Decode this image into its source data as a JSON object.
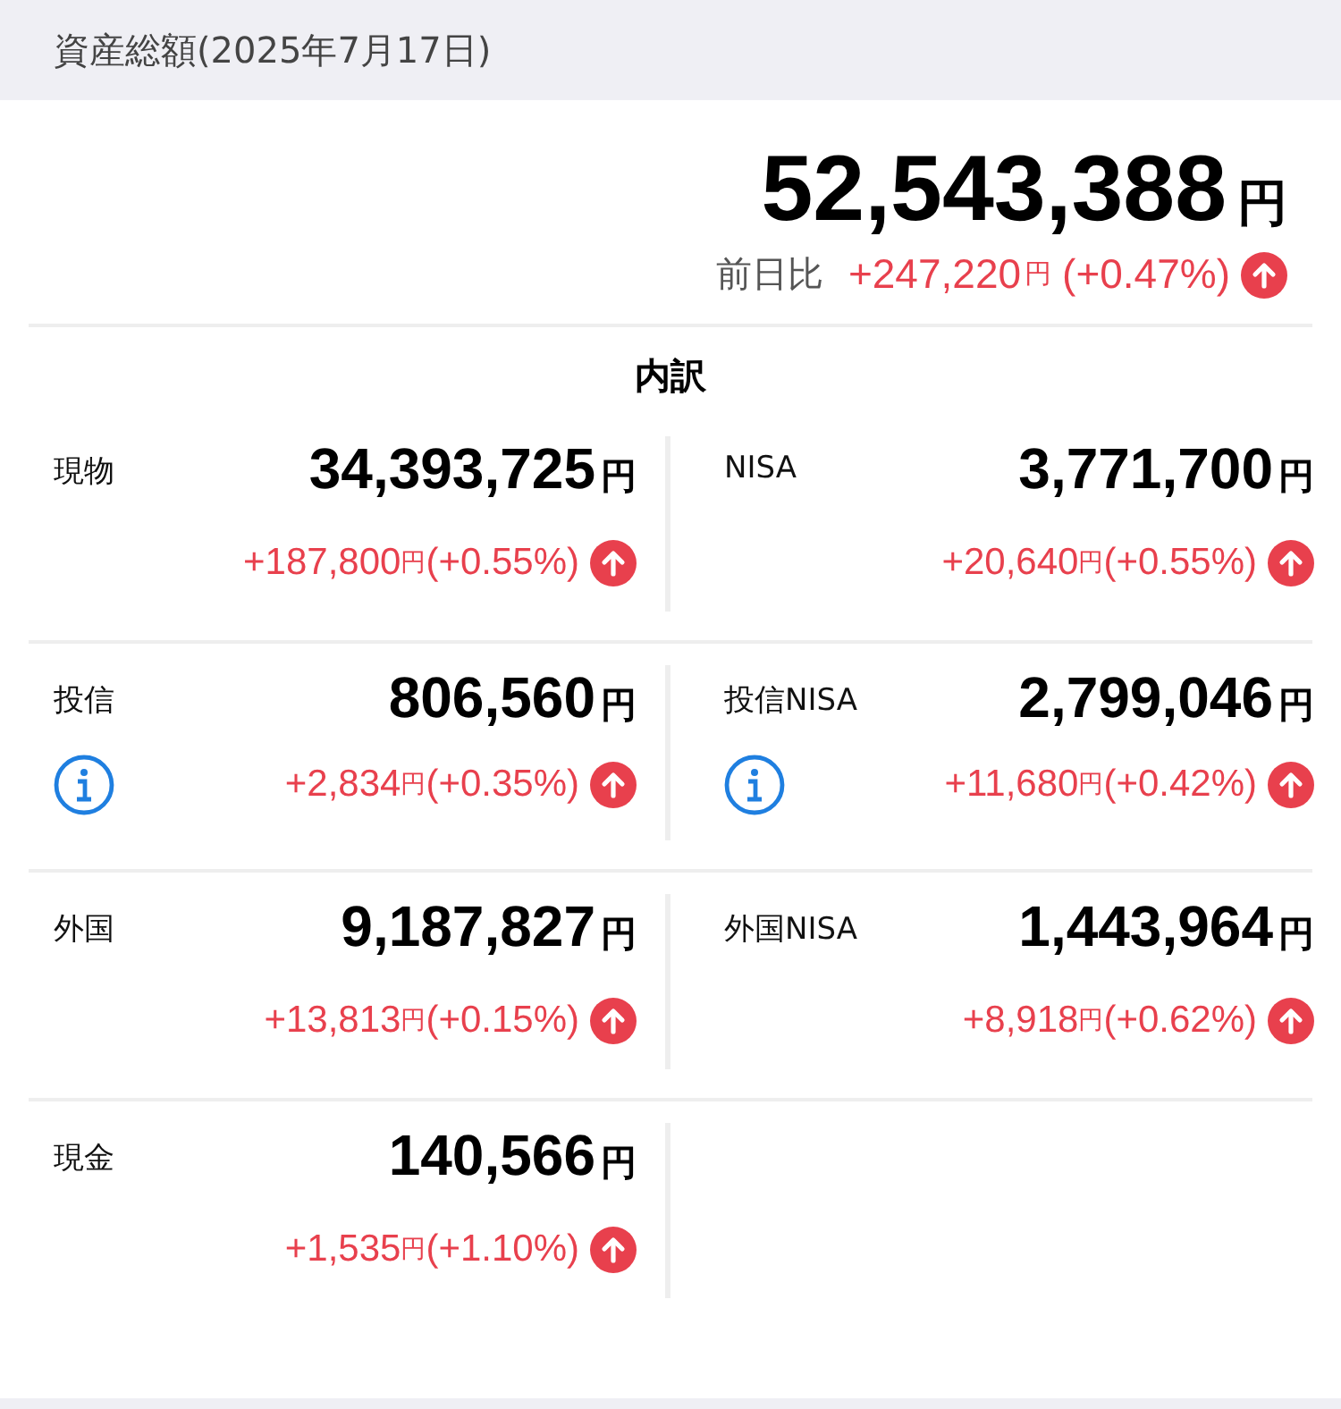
{
  "header": {
    "title": "資産総額(2025年7月17日)"
  },
  "total": {
    "amount": "52,543,388",
    "unit": "円",
    "change_label": "前日比",
    "change": "+247,220",
    "change_unit": "円",
    "change_pct": "(+0.47%)",
    "up": true
  },
  "breakdown": {
    "title": "内訳",
    "items": [
      {
        "label": "現物",
        "amount": "34,393,725",
        "unit": "円",
        "change": "+187,800",
        "change_unit": "円",
        "change_pct": "(+0.55%)",
        "up": true,
        "info": false
      },
      {
        "label": "NISA",
        "amount": "3,771,700",
        "unit": "円",
        "change": "+20,640",
        "change_unit": "円",
        "change_pct": "(+0.55%)",
        "up": true,
        "info": false
      },
      {
        "label": "投信",
        "amount": "806,560",
        "unit": "円",
        "change": "+2,834",
        "change_unit": "円",
        "change_pct": "(+0.35%)",
        "up": true,
        "info": true
      },
      {
        "label": "投信NISA",
        "amount": "2,799,046",
        "unit": "円",
        "change": "+11,680",
        "change_unit": "円",
        "change_pct": "(+0.42%)",
        "up": true,
        "info": true
      },
      {
        "label": "外国",
        "amount": "9,187,827",
        "unit": "円",
        "change": "+13,813",
        "change_unit": "円",
        "change_pct": "(+0.15%)",
        "up": true,
        "info": false
      },
      {
        "label": "外国NISA",
        "amount": "1,443,964",
        "unit": "円",
        "change": "+8,918",
        "change_unit": "円",
        "change_pct": "(+0.62%)",
        "up": true,
        "info": false
      },
      {
        "label": "現金",
        "amount": "140,566",
        "unit": "円",
        "change": "+1,535",
        "change_unit": "円",
        "change_pct": "(+1.10%)",
        "up": true,
        "info": false
      }
    ]
  }
}
